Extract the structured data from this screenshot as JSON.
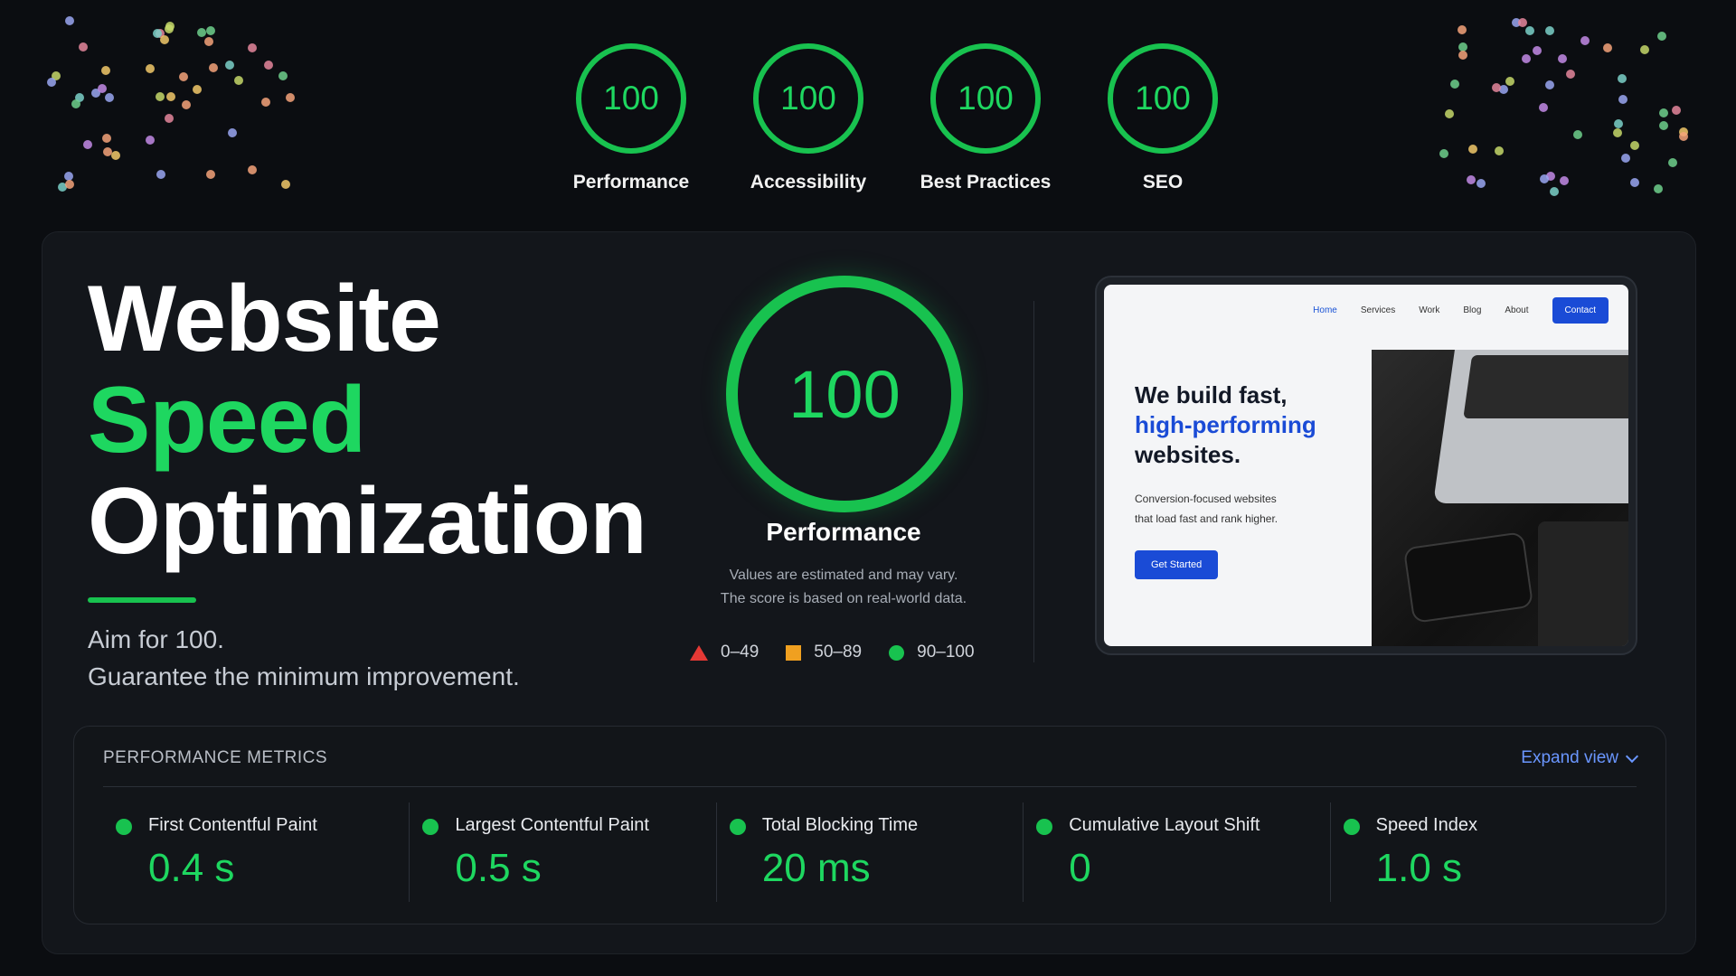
{
  "colors": {
    "accent": "#1ed760",
    "link": "#6a96ff",
    "fail": "#e53935",
    "average": "#f0a020"
  },
  "top_scores": [
    {
      "value": "100",
      "label": "Performance"
    },
    {
      "value": "100",
      "label": "Accessibility"
    },
    {
      "value": "100",
      "label": "Best Practices"
    },
    {
      "value": "100",
      "label": "SEO"
    }
  ],
  "hero": {
    "line1": "Website",
    "line2": "Speed",
    "line3": "Optimization",
    "sub1": "Aim for 100.",
    "sub2": "Guarantee the minimum improvement."
  },
  "gauge": {
    "value": "100",
    "label": "Performance",
    "note1": "Values are estimated and may vary.",
    "note2": "The score is based on real-world data."
  },
  "legend": [
    {
      "icon": "triangle-icon",
      "label": "0–49"
    },
    {
      "icon": "square-icon",
      "label": "50–89"
    },
    {
      "icon": "circle-icon",
      "label": "90–100"
    }
  ],
  "mockup": {
    "nav": [
      "Home",
      "Services",
      "Work",
      "Blog",
      "About"
    ],
    "contact": "Contact",
    "heading1": "We build fast,",
    "heading2": "high-performing",
    "heading3": "websites.",
    "para1": "Conversion-focused websites",
    "para2": "that load fast and rank higher.",
    "cta": "Get Started"
  },
  "metrics": {
    "title": "PERFORMANCE METRICS",
    "expand": "Expand view",
    "items": [
      {
        "name": "First Contentful Paint",
        "value": "0.4 s"
      },
      {
        "name": "Largest Contentful Paint",
        "value": "0.5 s"
      },
      {
        "name": "Total Blocking Time",
        "value": "20 ms"
      },
      {
        "name": "Cumulative Layout Shift",
        "value": "0"
      },
      {
        "name": "Speed Index",
        "value": "1.0 s"
      }
    ]
  }
}
